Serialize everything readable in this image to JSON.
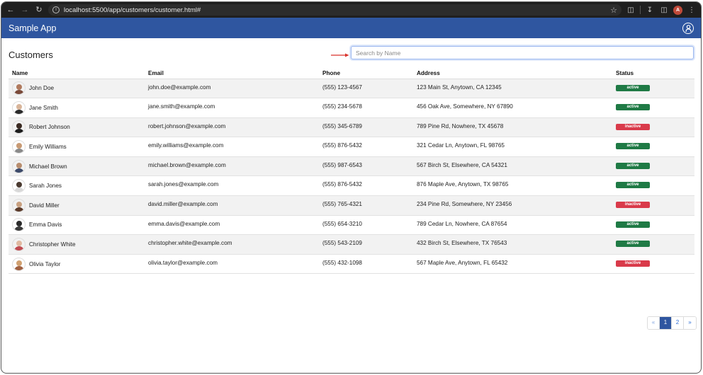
{
  "browser": {
    "url": "localhost:5500/app/customers/customer.html#",
    "profile_initial": "A"
  },
  "app": {
    "brand": "Sample App"
  },
  "page": {
    "title": "Customers",
    "search_placeholder": "Search by Name"
  },
  "table": {
    "headers": {
      "name": "Name",
      "email": "Email",
      "phone": "Phone",
      "address": "Address",
      "status": "Status"
    },
    "rows": [
      {
        "name": "John Doe",
        "email": "john.doe@example.com",
        "phone": "(555) 123-4567",
        "address": "123 Main St, Anytown, CA 12345",
        "status": "active"
      },
      {
        "name": "Jane Smith",
        "email": "jane.smith@example.com",
        "phone": "(555) 234-5678",
        "address": "456 Oak Ave, Somewhere, NY 67890",
        "status": "active"
      },
      {
        "name": "Robert Johnson",
        "email": "robert.johnson@example.com",
        "phone": "(555) 345-6789",
        "address": "789 Pine Rd, Nowhere, TX 45678",
        "status": "inactive"
      },
      {
        "name": "Emily Williams",
        "email": "emily.williams@example.com",
        "phone": "(555) 876-5432",
        "address": "321 Cedar Ln, Anytown, FL 98765",
        "status": "active"
      },
      {
        "name": "Michael Brown",
        "email": "michael.brown@example.com",
        "phone": "(555) 987-6543",
        "address": "567 Birch St, Elsewhere, CA 54321",
        "status": "active"
      },
      {
        "name": "Sarah Jones",
        "email": "sarah.jones@example.com",
        "phone": "(555) 876-5432",
        "address": "876 Maple Ave, Anytown, TX 98765",
        "status": "active"
      },
      {
        "name": "David Miller",
        "email": "david.miller@example.com",
        "phone": "(555) 765-4321",
        "address": "234 Pine Rd, Somewhere, NY 23456",
        "status": "inactive"
      },
      {
        "name": "Emma Davis",
        "email": "emma.davis@example.com",
        "phone": "(555) 654-3210",
        "address": "789 Cedar Ln, Nowhere, CA 87654",
        "status": "active"
      },
      {
        "name": "Christopher White",
        "email": "christopher.white@example.com",
        "phone": "(555) 543-2109",
        "address": "432 Birch St, Elsewhere, TX 76543",
        "status": "active"
      },
      {
        "name": "Olivia Taylor",
        "email": "olivia.taylor@example.com",
        "phone": "(555) 432-1098",
        "address": "567 Maple Ave, Anytown, FL 65432",
        "status": "inactive"
      }
    ]
  },
  "pagination": {
    "prev": "«",
    "pages": [
      "1",
      "2"
    ],
    "current": "1",
    "next": "»"
  },
  "colors": {
    "navbar": "#2f56a0",
    "active": "#1f7a45",
    "inactive": "#d93a4a",
    "annotation_arrow": "#d9322b"
  },
  "avatar_palette": [
    {
      "head": "#b07a5e",
      "body": "#7a4a3a"
    },
    {
      "head": "#d8b59a",
      "body": "#2b2b2b"
    },
    {
      "head": "#3a2a22",
      "body": "#1c1c1c"
    },
    {
      "head": "#c89a74",
      "body": "#8a8a8a"
    },
    {
      "head": "#b88d6e",
      "body": "#3c4a6a"
    },
    {
      "head": "#4a3a30",
      "body": "#d8d8d8"
    },
    {
      "head": "#c8a080",
      "body": "#5a3a2a"
    },
    {
      "head": "#2a2a2a",
      "body": "#3a3a3a"
    },
    {
      "head": "#e0b8a0",
      "body": "#c04a50"
    },
    {
      "head": "#d0a070",
      "body": "#a06040"
    }
  ]
}
